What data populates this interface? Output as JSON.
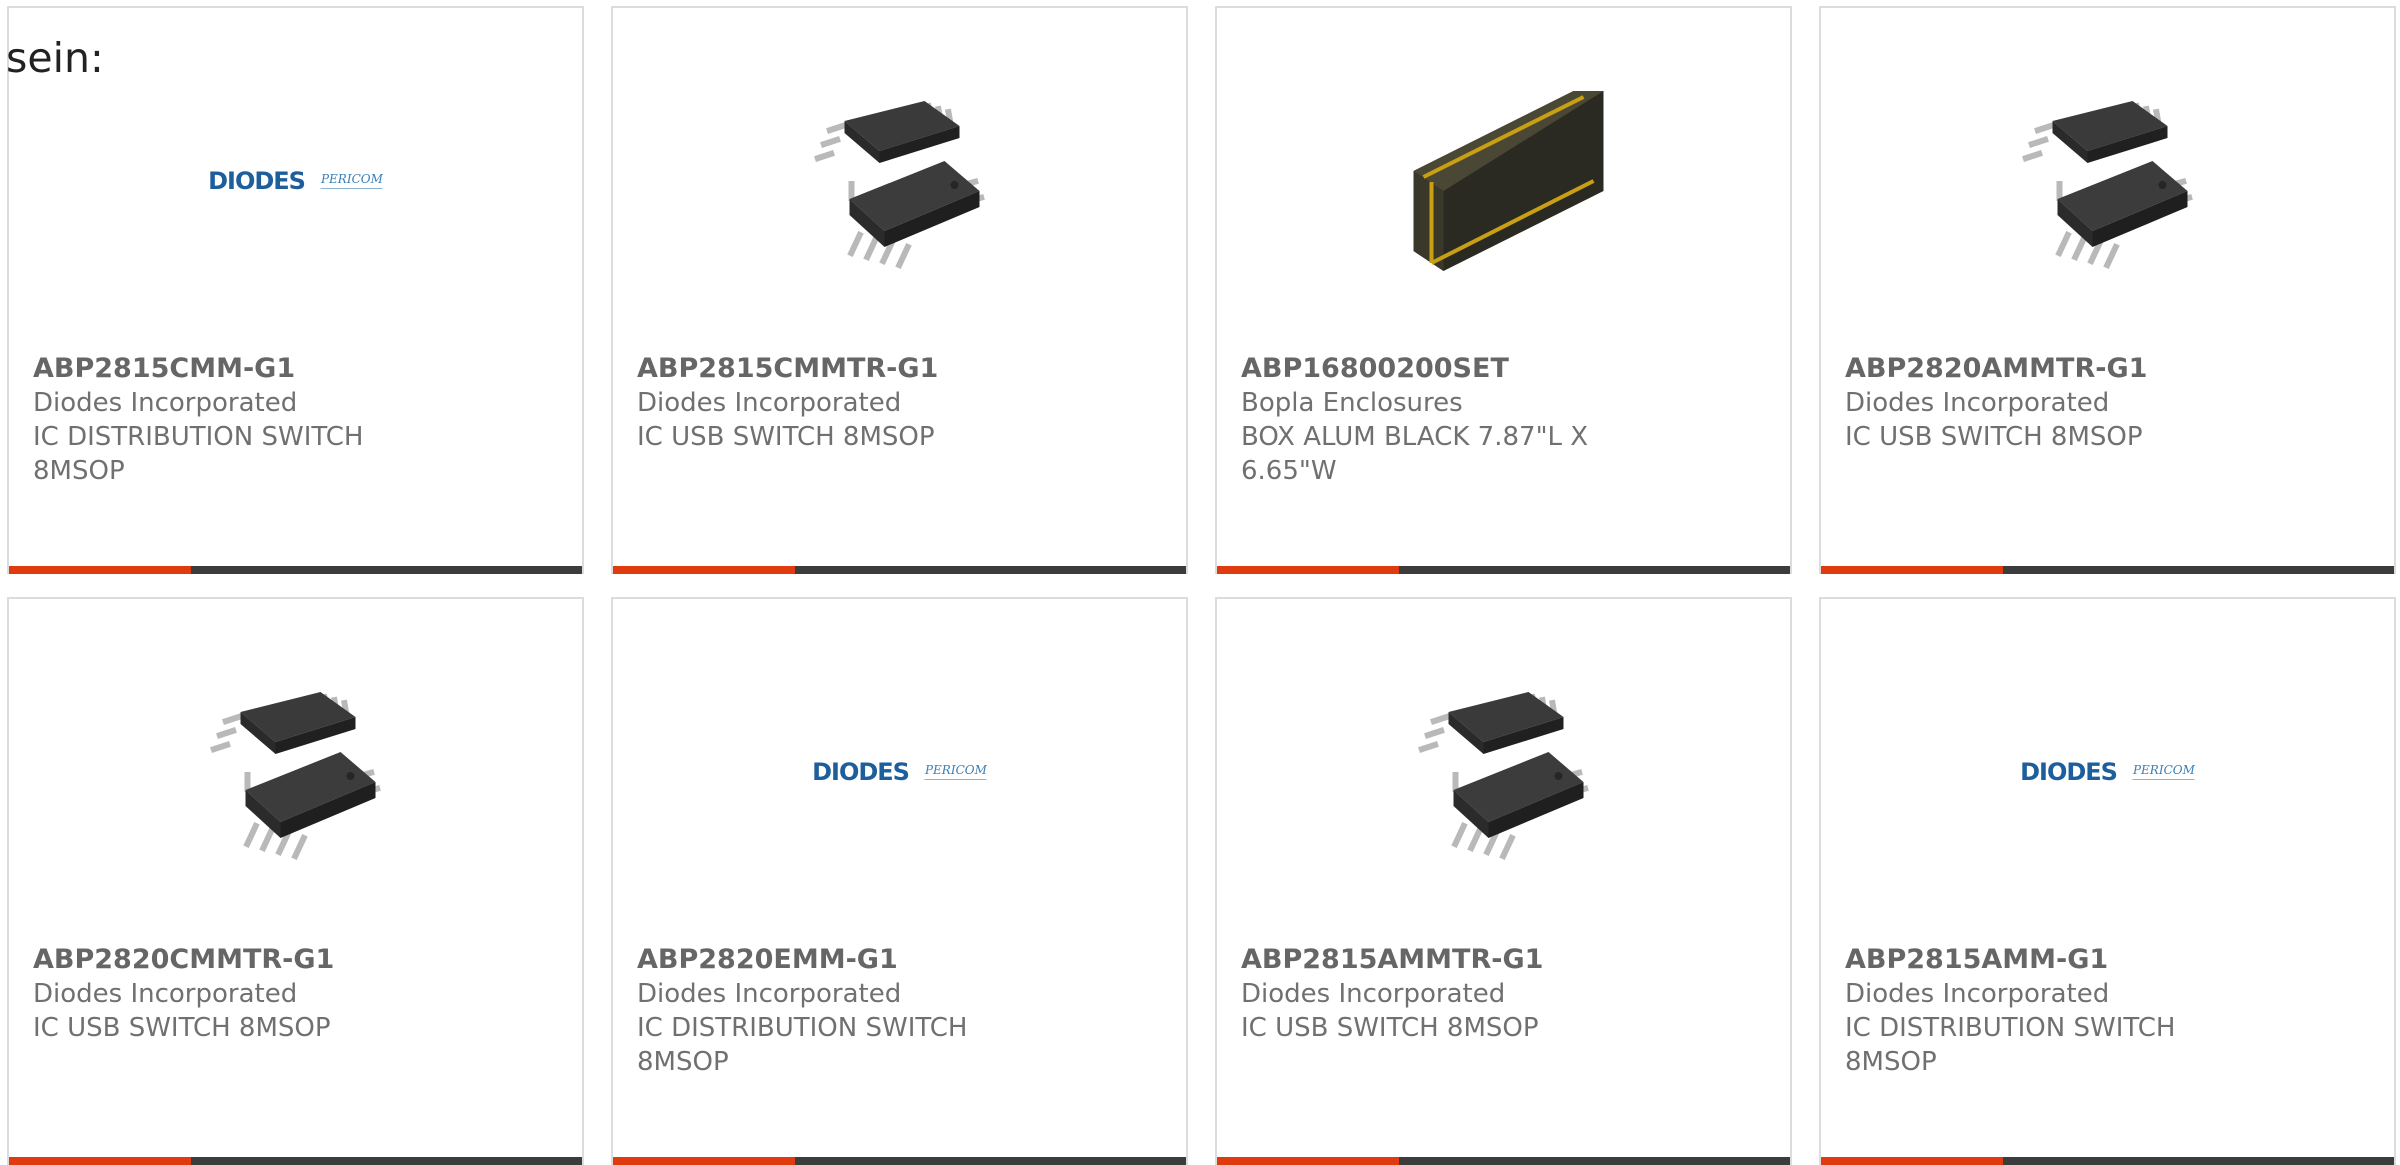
{
  "heading": "sein:",
  "colors": {
    "accent": "#e03a0f",
    "bar": "#3c3c3c",
    "border": "#dcdcdc"
  },
  "products": [
    {
      "part": "ABP2815CMM-G1",
      "manufacturer": "Diodes Incorporated",
      "description": "IC DISTRIBUTION SWITCH 8MSOP",
      "image": "diodes-pericom-logo",
      "logo_text": "DIODES",
      "logo_sub": "PERICOM"
    },
    {
      "part": "ABP2815CMMTR-G1",
      "manufacturer": "Diodes Incorporated",
      "description": "IC USB SWITCH 8MSOP",
      "image": "msop-chip-icon"
    },
    {
      "part": "ABP16800200SET",
      "manufacturer": "Bopla Enclosures",
      "description": "BOX ALUM BLACK 7.87\"L X 6.65\"W",
      "image": "enclosure-box-icon"
    },
    {
      "part": "ABP2820AMMTR-G1",
      "manufacturer": "Diodes Incorporated",
      "description": "IC USB SWITCH 8MSOP",
      "image": "msop-chip-icon"
    },
    {
      "part": "ABP2820CMMTR-G1",
      "manufacturer": "Diodes Incorporated",
      "description": "IC USB SWITCH 8MSOP",
      "image": "msop-chip-icon"
    },
    {
      "part": "ABP2820EMM-G1",
      "manufacturer": "Diodes Incorporated",
      "description": "IC DISTRIBUTION SWITCH 8MSOP",
      "image": "diodes-pericom-logo",
      "logo_text": "DIODES",
      "logo_sub": "PERICOM"
    },
    {
      "part": "ABP2815AMMTR-G1",
      "manufacturer": "Diodes Incorporated",
      "description": "IC USB SWITCH 8MSOP",
      "image": "msop-chip-icon"
    },
    {
      "part": "ABP2815AMM-G1",
      "manufacturer": "Diodes Incorporated",
      "description": "IC DISTRIBUTION SWITCH 8MSOP",
      "image": "diodes-pericom-logo",
      "logo_text": "DIODES",
      "logo_sub": "PERICOM"
    }
  ]
}
